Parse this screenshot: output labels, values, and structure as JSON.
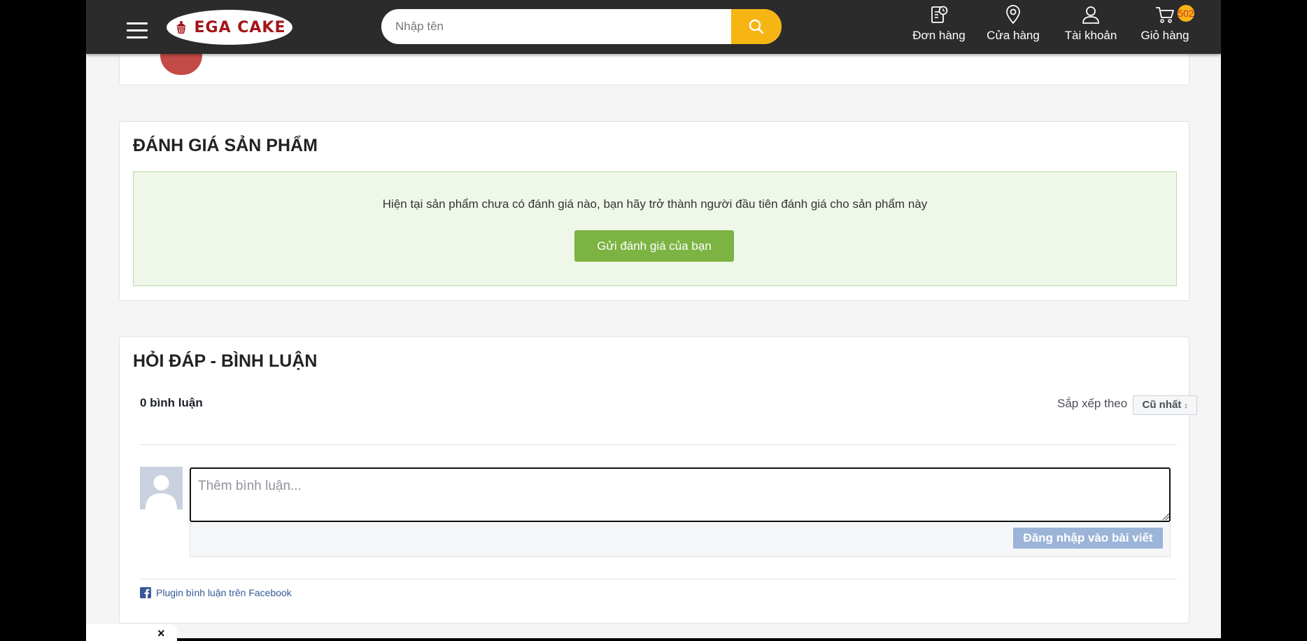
{
  "header": {
    "brand": "EGA CAKE",
    "search_placeholder": "Nhập tên",
    "nav": {
      "orders": "Đơn hàng",
      "stores": "Cửa hàng",
      "account": "Tài khoản",
      "cart": "Giỏ hàng",
      "cart_count": "502"
    }
  },
  "review": {
    "title": "ĐÁNH GIÁ SẢN PHẨM",
    "empty_text": "Hiện tại sản phẩm chưa có đánh giá nào, bạn hãy trở thành người đầu tiên đánh giá cho sản phẩm này",
    "button": "Gửi đánh giá của bạn"
  },
  "comments": {
    "title": "HỎI ĐÁP - BÌNH LUẬN",
    "count": "0 bình luận",
    "sort_label": "Sắp xếp theo",
    "sort_value": "Cũ nhất",
    "input_placeholder": "Thêm bình luận...",
    "login_button": "Đăng nhập vào bài viết",
    "plugin_text": "Plugin bình luận trên Facebook"
  },
  "popup": {
    "close": "×"
  }
}
